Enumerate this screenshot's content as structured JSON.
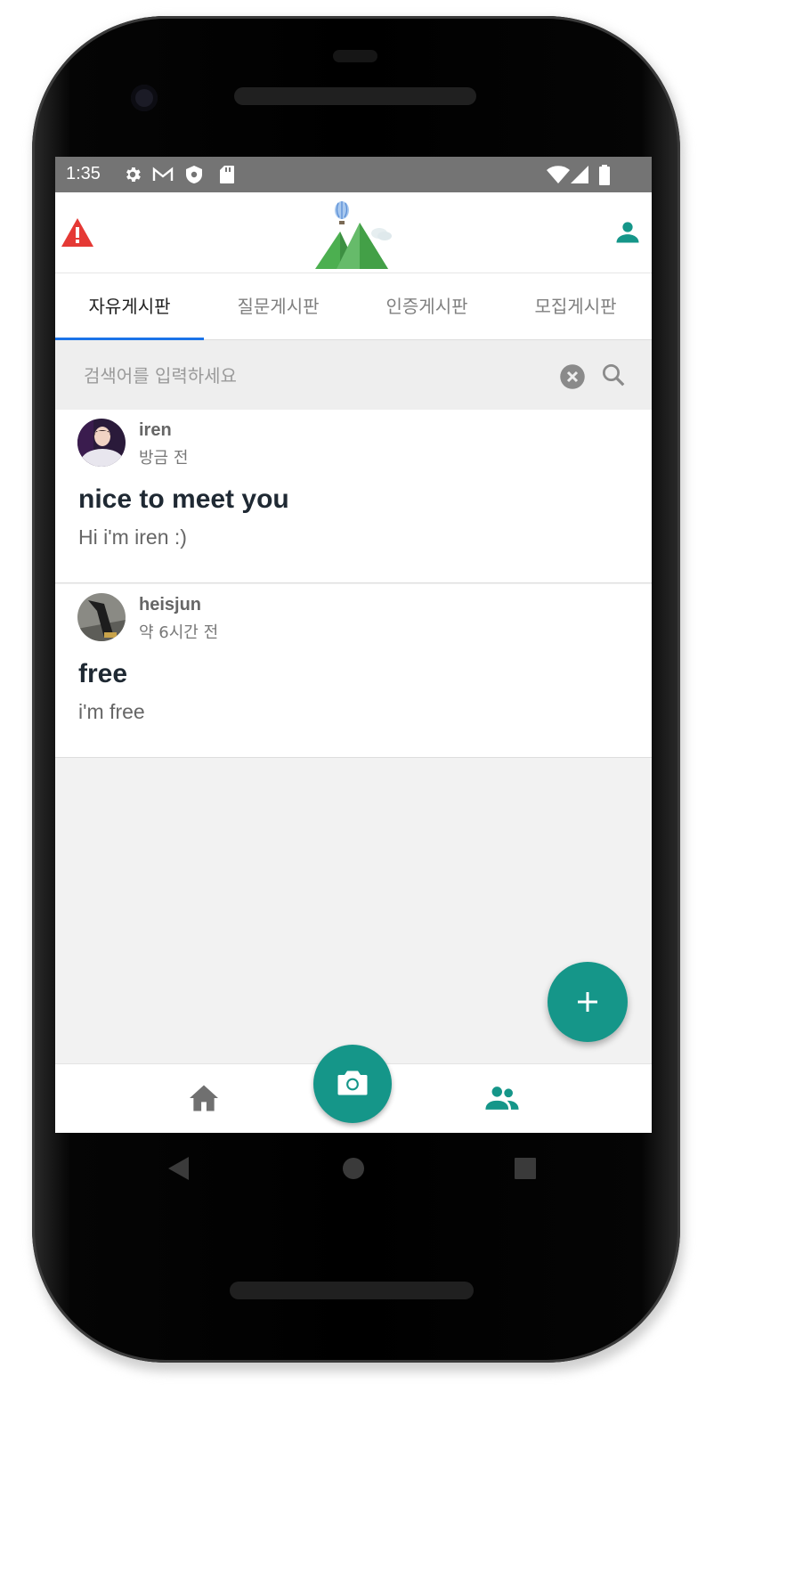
{
  "status_bar": {
    "time": "1:35",
    "icons": [
      "settings-icon",
      "gmail-icon",
      "shield-icon",
      "sd-card-icon",
      "wifi-icon",
      "signal-icon",
      "battery-icon"
    ]
  },
  "header": {
    "icons": [
      "warning-icon",
      "balloon-mountain-logo",
      "profile-icon"
    ]
  },
  "tabs": [
    {
      "label": "자유게시판",
      "active": true
    },
    {
      "label": "질문게시판",
      "active": false
    },
    {
      "label": "인증게시판",
      "active": false
    },
    {
      "label": "모집게시판",
      "active": false
    }
  ],
  "search": {
    "placeholder": "검색어를 입력하세요",
    "value": ""
  },
  "posts": [
    {
      "author": "iren",
      "time": "방금 전",
      "title": "nice to meet you",
      "body": "Hi i'm iren :)"
    },
    {
      "author": "heisjun",
      "time": "약 6시간 전",
      "title": "free",
      "body": "i'm free"
    }
  ],
  "bottom_nav": {
    "items": [
      "home-icon",
      "camera-icon",
      "community-icon"
    ],
    "active": "community-icon"
  },
  "colors": {
    "accent": "#159689",
    "tab_indicator": "#1a73e8",
    "warning": "#e53935",
    "status_bar": "#747474"
  }
}
